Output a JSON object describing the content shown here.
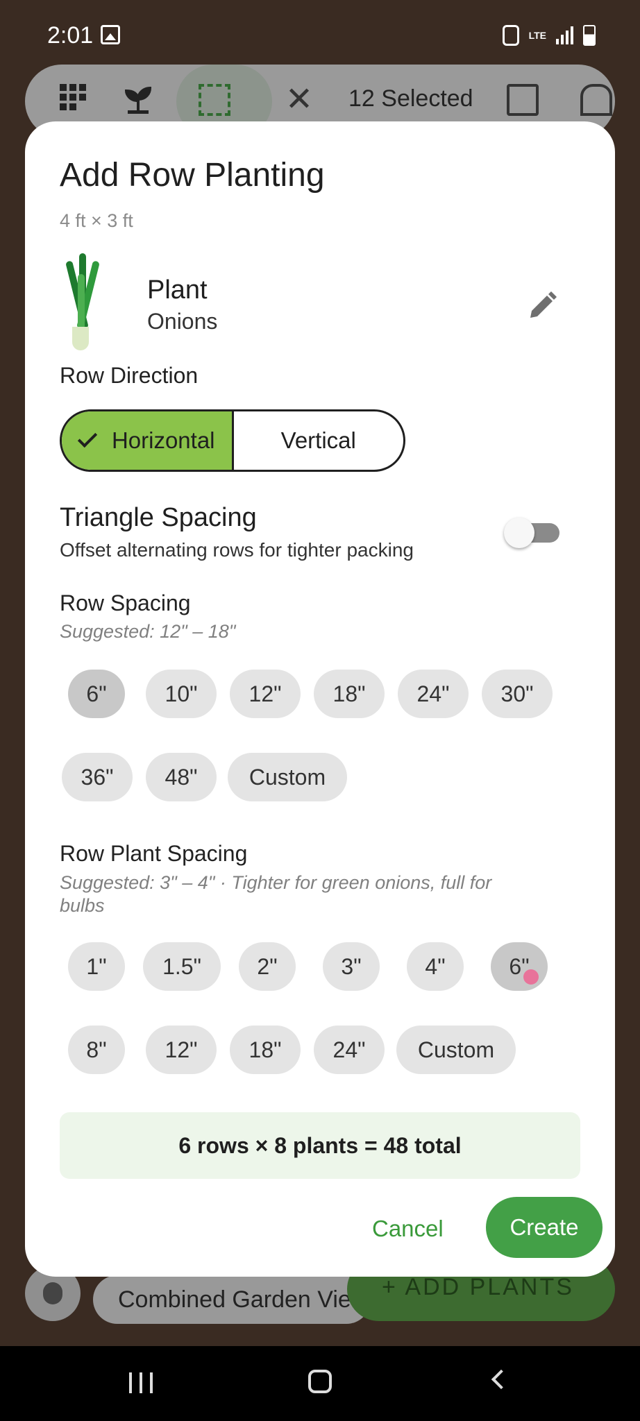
{
  "status_bar": {
    "time": "2:01",
    "network": "LTE"
  },
  "toolbar": {
    "selected_count": "12 Selected",
    "close_glyph": "✕"
  },
  "bottom": {
    "view_label": "Combined Garden Vie",
    "add_plants_label": "+ ADD PLANTS"
  },
  "dialog": {
    "title": "Add Row Planting",
    "size": "4 ft × 3 ft",
    "plant": {
      "label": "Plant",
      "name": "Onions"
    },
    "row_direction": {
      "label": "Row Direction",
      "options": [
        "Horizontal",
        "Vertical"
      ],
      "selected": "Horizontal"
    },
    "triangle_spacing": {
      "title": "Triangle Spacing",
      "subtitle": "Offset alternating rows for tighter packing",
      "enabled": false
    },
    "row_spacing": {
      "label": "Row Spacing",
      "hint": "Suggested: 12\" – 18\"",
      "options": [
        "6\"",
        "10\"",
        "12\"",
        "18\"",
        "24\"",
        "30\"",
        "36\"",
        "48\"",
        "Custom"
      ],
      "selected": "6\""
    },
    "row_plant_spacing": {
      "label": "Row Plant Spacing",
      "hint_line1": "Suggested: 3\" – 4\" · Tighter for green onions, full for",
      "hint_line2": "bulbs",
      "options": [
        "1\"",
        "1.5\"",
        "2\"",
        "3\"",
        "4\"",
        "6\"",
        "8\"",
        "12\"",
        "18\"",
        "24\"",
        "Custom"
      ],
      "selected": "6\""
    },
    "summary": "6 rows × 8 plants = 48 total",
    "cancel_label": "Cancel",
    "create_label": "Create"
  },
  "colors": {
    "accent_green": "#8bc34a",
    "primary_green": "#43a047",
    "summary_bg": "#edf6ea",
    "touch_indicator": "#e8739a"
  }
}
